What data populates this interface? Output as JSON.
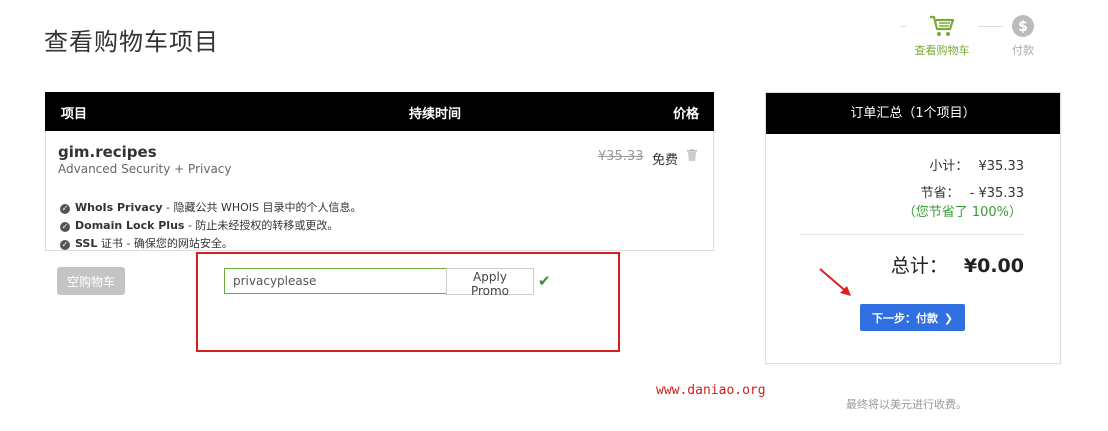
{
  "page_title": "查看购物车项目",
  "stepper": {
    "cart_label": "查看购物车",
    "pay_label": "付款",
    "active_color": "#7aa83a",
    "inactive_color": "#aaaaaa"
  },
  "cart_table": {
    "headers": {
      "item": "项目",
      "duration": "持续时间",
      "price": "价格"
    },
    "item": {
      "domain": "gim.recipes",
      "product": "Advanced Security + Privacy",
      "old_price": "¥35.33",
      "price": "免费",
      "features": [
        {
          "name": "WhoIs Privacy",
          "desc": " - 隐藏公共 WHOIS 目录中的个人信息。"
        },
        {
          "name": "Domain Lock Plus",
          "desc": " - 防止未经授权的转移或更改。"
        },
        {
          "name": "SSL",
          "desc": " 证书 - 确保您的网站安全。"
        }
      ]
    }
  },
  "empty_cart_button": "空购物车",
  "promo": {
    "value": "privacyplease",
    "button_label": "Apply Promo",
    "status_icon": "checkmark-icon"
  },
  "summary": {
    "title": "订单汇总（1个项目）",
    "subtotal_label": "小计：",
    "subtotal_value": "¥35.33",
    "savings_label": "节省：",
    "savings_value": "- ¥35.33",
    "saved_note": "（您节省了 100%）",
    "total_label": "总计：",
    "total_value": "¥0.00",
    "next_button": "下一步：付款",
    "next_button_color": "#2f6fdf"
  },
  "watermark": "www.daniao.org",
  "currency_note": "最终将以美元进行收费。"
}
